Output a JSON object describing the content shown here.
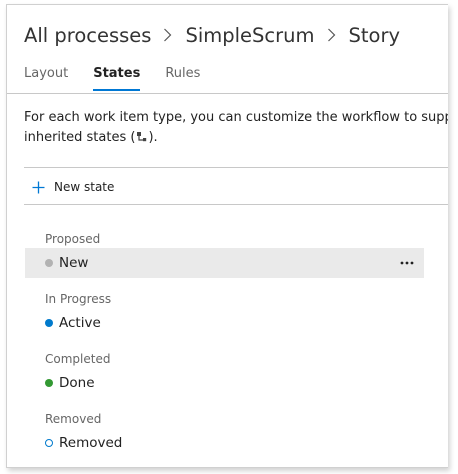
{
  "breadcrumb": {
    "items": [
      "All processes",
      "SimpleScrum",
      "Story"
    ]
  },
  "tabs": [
    {
      "label": "Layout",
      "active": false
    },
    {
      "label": "States",
      "active": true
    },
    {
      "label": "Rules",
      "active": false
    }
  ],
  "description": {
    "line1": "For each work item type, you can customize the workflow to support",
    "line2_prefix": "inherited states (",
    "line2_suffix": ")."
  },
  "toolbar": {
    "new_state_label": "New state",
    "icon": "plus-icon"
  },
  "groups": [
    {
      "category": "Proposed",
      "state": "New",
      "color": "#b2b2b2",
      "dot_style": "filled",
      "selected": true
    },
    {
      "category": "In Progress",
      "state": "Active",
      "color": "#007acc",
      "dot_style": "filled",
      "selected": false
    },
    {
      "category": "Completed",
      "state": "Done",
      "color": "#339933",
      "dot_style": "filled",
      "selected": false
    },
    {
      "category": "Removed",
      "state": "Removed",
      "color": "#007acc",
      "dot_style": "outline",
      "selected": false
    }
  ],
  "colors": {
    "accent": "#0078d4",
    "selected_row": "#eaeaea"
  }
}
